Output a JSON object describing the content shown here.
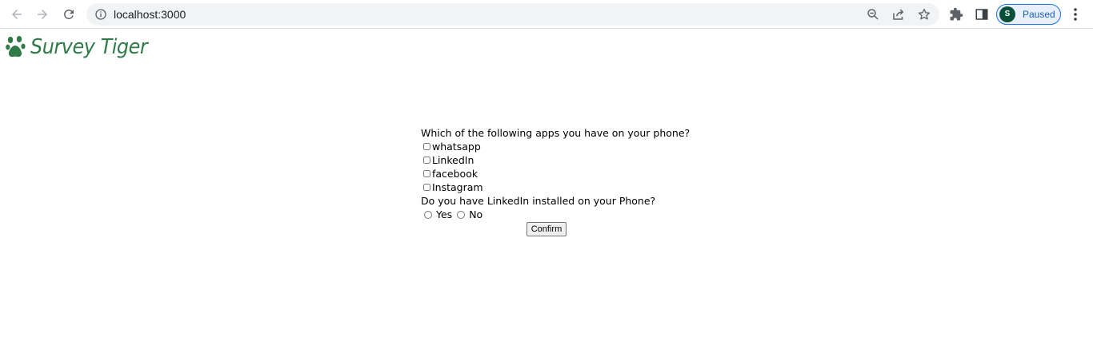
{
  "browser": {
    "url": "localhost:3000",
    "profile_initial": "S",
    "profile_status": "Paused",
    "icons": {
      "back": "arrow-left-icon",
      "forward": "arrow-right-icon",
      "reload": "reload-icon",
      "site_info": "info-icon",
      "zoom": "zoom-icon",
      "share": "share-icon",
      "bookmark": "star-icon",
      "extensions": "puzzle-icon",
      "side_panel": "side-panel-icon",
      "menu": "more-vert-icon"
    }
  },
  "app": {
    "logo_text": "Survey Tiger",
    "logo_icon": "paw-icon",
    "brand_color": "#2f7a47"
  },
  "survey": {
    "question1": "Which of the following apps you have on your phone?",
    "options": [
      "whatsapp",
      "LinkedIn",
      "facebook",
      "Instagram"
    ],
    "question2": "Do you have LinkedIn installed on your Phone?",
    "radio_yes": "Yes",
    "radio_no": "No",
    "confirm_label": "Confirm"
  }
}
